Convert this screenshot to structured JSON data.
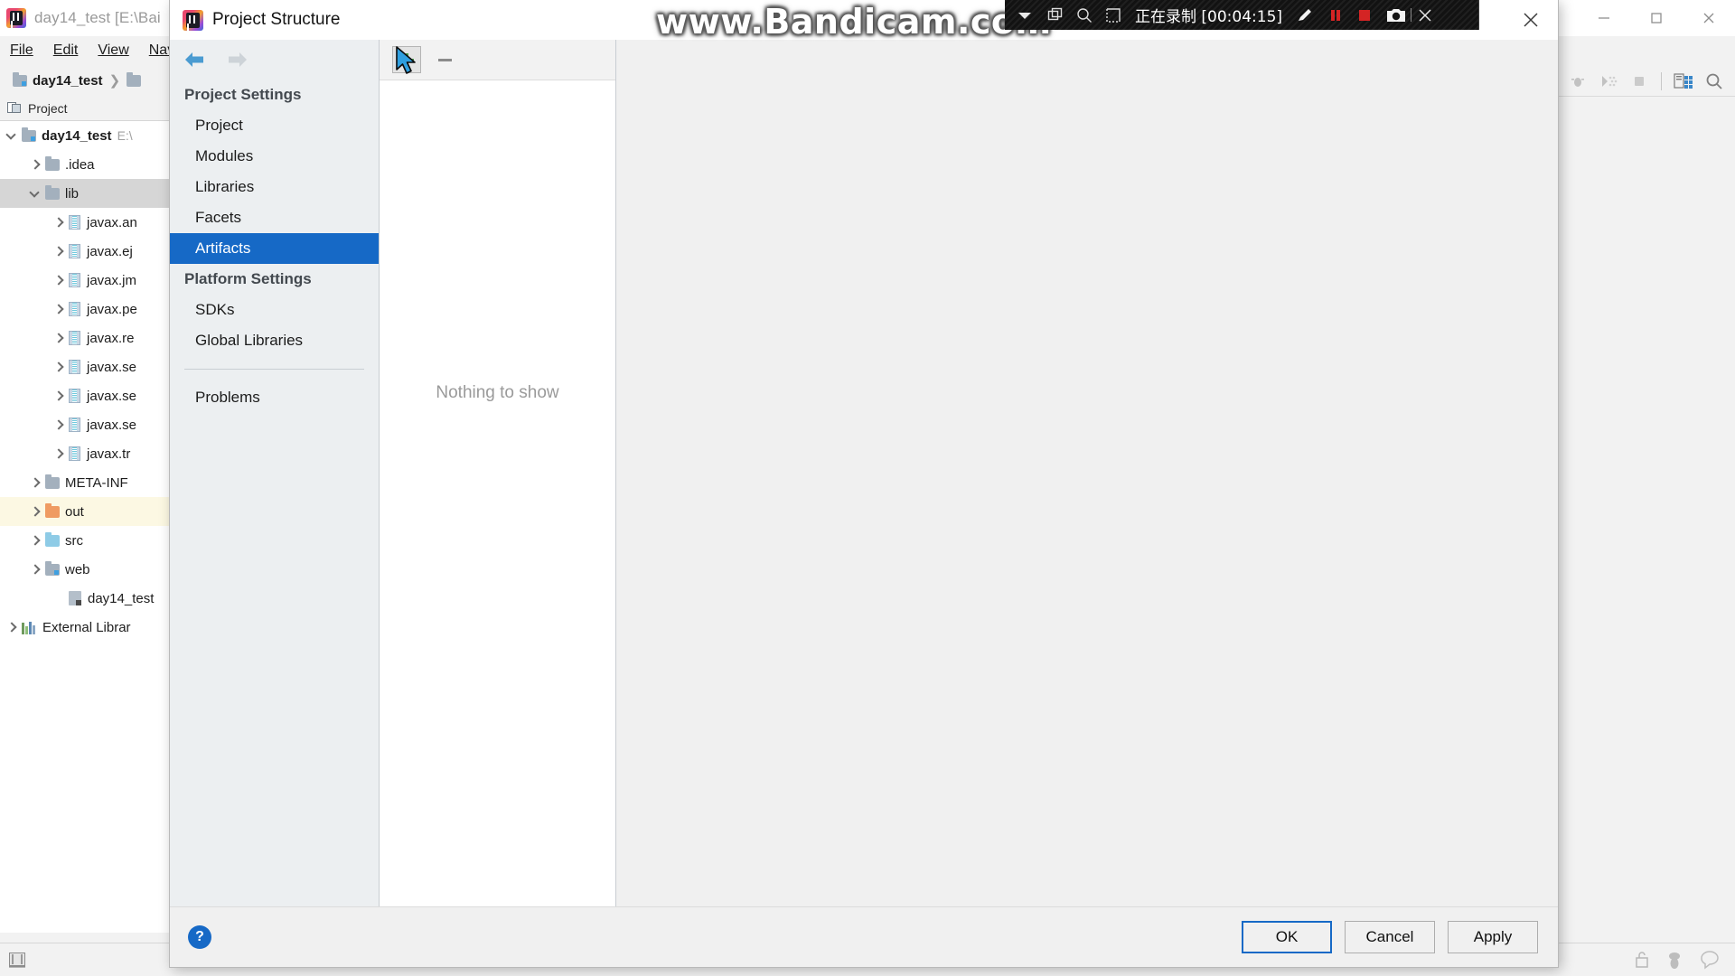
{
  "ide": {
    "title": "day14_test [E:\\Bai",
    "logo_name": "intellij-idea-logo",
    "menu": [
      {
        "label": "File"
      },
      {
        "label": "Edit"
      },
      {
        "label": "View"
      },
      {
        "label": "Nav"
      }
    ],
    "breadcrumb": [
      {
        "label": "day14_test",
        "icon": "module-folder-icon"
      },
      {
        "label": "",
        "icon": "folder-icon"
      }
    ],
    "toolwindow": {
      "label": "Project",
      "icon": "project-toolwindow-icon"
    },
    "tree": [
      {
        "label": "day14_test",
        "path": "E:\\",
        "icon": "module-folder-icon",
        "indent": 0,
        "arrow": "down",
        "bold": true,
        "state": "normal"
      },
      {
        "label": ".idea",
        "path": "",
        "icon": "folder-icon",
        "indent": 1,
        "arrow": "right",
        "bold": false,
        "state": "normal"
      },
      {
        "label": "lib",
        "path": "",
        "icon": "folder-icon",
        "indent": 1,
        "arrow": "down",
        "bold": false,
        "state": "selected"
      },
      {
        "label": "javax.an",
        "path": "",
        "icon": "jar-icon",
        "indent": 2,
        "arrow": "right",
        "bold": false,
        "state": "normal"
      },
      {
        "label": "javax.ej",
        "path": "",
        "icon": "jar-icon",
        "indent": 2,
        "arrow": "right",
        "bold": false,
        "state": "normal"
      },
      {
        "label": "javax.jm",
        "path": "",
        "icon": "jar-icon",
        "indent": 2,
        "arrow": "right",
        "bold": false,
        "state": "normal"
      },
      {
        "label": "javax.pe",
        "path": "",
        "icon": "jar-icon",
        "indent": 2,
        "arrow": "right",
        "bold": false,
        "state": "normal"
      },
      {
        "label": "javax.re",
        "path": "",
        "icon": "jar-icon",
        "indent": 2,
        "arrow": "right",
        "bold": false,
        "state": "normal"
      },
      {
        "label": "javax.se",
        "path": "",
        "icon": "jar-icon",
        "indent": 2,
        "arrow": "right",
        "bold": false,
        "state": "normal"
      },
      {
        "label": "javax.se",
        "path": "",
        "icon": "jar-icon",
        "indent": 2,
        "arrow": "right",
        "bold": false,
        "state": "normal"
      },
      {
        "label": "javax.se",
        "path": "",
        "icon": "jar-icon",
        "indent": 2,
        "arrow": "right",
        "bold": false,
        "state": "normal"
      },
      {
        "label": "javax.tr",
        "path": "",
        "icon": "jar-icon",
        "indent": 2,
        "arrow": "right",
        "bold": false,
        "state": "normal"
      },
      {
        "label": "META-INF",
        "path": "",
        "icon": "folder-icon",
        "indent": 1,
        "arrow": "right",
        "bold": false,
        "state": "normal"
      },
      {
        "label": "out",
        "path": "",
        "icon": "out-folder-icon",
        "indent": 1,
        "arrow": "right",
        "bold": false,
        "state": "highlight"
      },
      {
        "label": "src",
        "path": "",
        "icon": "source-folder-icon",
        "indent": 1,
        "arrow": "right",
        "bold": false,
        "state": "normal"
      },
      {
        "label": "web",
        "path": "",
        "icon": "web-folder-icon",
        "indent": 1,
        "arrow": "right",
        "bold": false,
        "state": "normal"
      },
      {
        "label": "day14_test",
        "path": "",
        "icon": "iml-file-icon",
        "indent": 2,
        "arrow": "none",
        "bold": false,
        "state": "normal"
      },
      {
        "label": "External Librar",
        "path": "",
        "icon": "libraries-icon",
        "indent": 0,
        "arrow": "right",
        "bold": false,
        "state": "normal"
      }
    ],
    "window_buttons": [
      {
        "name": "minimize-button",
        "glyph": "minimize-icon"
      },
      {
        "name": "maximize-button",
        "glyph": "maximize-icon"
      },
      {
        "name": "close-button",
        "glyph": "close-icon"
      }
    ],
    "toolbar_icons": [
      {
        "name": "debug-icon"
      },
      {
        "name": "coverage-icon"
      },
      {
        "name": "stop-icon"
      },
      {
        "name": "database-icon"
      },
      {
        "name": "search-everywhere-icon"
      }
    ],
    "status_icons": [
      {
        "name": "todo-toolwindow-icon"
      },
      {
        "name": "lock-icon"
      },
      {
        "name": "inspector-icon"
      },
      {
        "name": "notifications-icon"
      }
    ]
  },
  "bandicam": {
    "watermark": "www.Bandicam.com",
    "status_text": "正在录制 [00:04:15]",
    "icons": [
      {
        "name": "dropdown-arrow-icon"
      },
      {
        "name": "window-target-icon"
      },
      {
        "name": "magnifier-icon"
      },
      {
        "name": "region-select-icon"
      }
    ],
    "controls": [
      {
        "name": "draw-pencil-icon"
      },
      {
        "name": "pause-icon",
        "color": "#d42424"
      },
      {
        "name": "stop-record-icon",
        "color": "#d42424"
      },
      {
        "name": "screenshot-camera-icon"
      },
      {
        "name": "close-bandicam-icon"
      }
    ],
    "accent": "#d42424"
  },
  "dialog": {
    "title": "Project Structure",
    "logo_name": "intellij-idea-logo",
    "close_label": "close-icon",
    "nav": {
      "back": "back-arrow-icon",
      "forward": "forward-arrow-icon"
    },
    "sidebar": {
      "groups": [
        {
          "title": "Project Settings",
          "items": [
            {
              "label": "Project",
              "active": false
            },
            {
              "label": "Modules",
              "active": false
            },
            {
              "label": "Libraries",
              "active": false
            },
            {
              "label": "Facets",
              "active": false
            },
            {
              "label": "Artifacts",
              "active": true
            }
          ]
        },
        {
          "title": "Platform Settings",
          "items": [
            {
              "label": "SDKs",
              "active": false
            },
            {
              "label": "Global Libraries",
              "active": false
            }
          ]
        }
      ],
      "extra": [
        {
          "label": "Problems",
          "active": false
        }
      ]
    },
    "list_pane": {
      "toolbar": [
        {
          "name": "add-artifact-button",
          "glyph": "plus-icon",
          "hovered": true
        },
        {
          "name": "remove-artifact-button",
          "glyph": "minus-icon",
          "hovered": false
        }
      ],
      "empty_text": "Nothing to show"
    },
    "footer": {
      "help_label": "?",
      "buttons": [
        {
          "label": "OK",
          "default": true
        },
        {
          "label": "Cancel",
          "default": false
        },
        {
          "label": "Apply",
          "default": false
        }
      ]
    }
  },
  "accent_colors": {
    "selection_blue": "#1669c6",
    "highlight_yellow": "#fcf8e3",
    "tree_selection_gray": "#d6d6d6",
    "plus_green": "#4a9c4a"
  }
}
